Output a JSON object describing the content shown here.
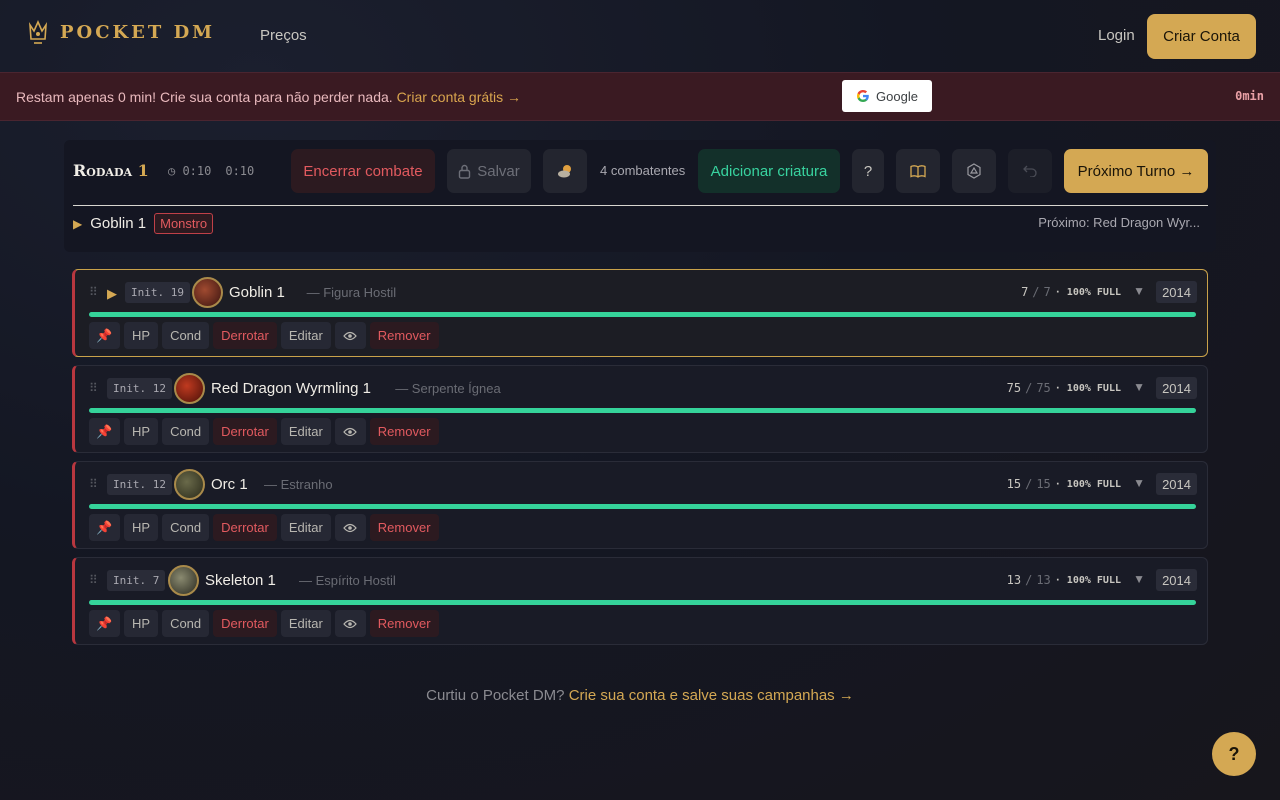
{
  "header": {
    "logo_text": "POCKET DM",
    "nav_precos": "Preços",
    "login": "Login",
    "criar_conta": "Criar Conta"
  },
  "banner": {
    "message": "Restam apenas 0 min! Crie sua conta para não perder nada.",
    "link": "Criar conta grátis →",
    "google_label": "Google",
    "timer": "0min"
  },
  "combat": {
    "rodada_label": "Rodada",
    "rodada_num": "1",
    "time1": "0:10",
    "time2": "0:10",
    "encerrar": "Encerrar combate",
    "salvar": "Salvar",
    "combatentes": "4 combatentes",
    "adicionar": "Adicionar criatura",
    "help": "?",
    "proximo": "Próximo Turno →",
    "current_name": "Goblin 1",
    "current_badge": "Monstro",
    "next_label": "Próximo: Red Dragon Wyr..."
  },
  "actions": {
    "hp": "HP",
    "cond": "Cond",
    "derrotar": "Derrotar",
    "editar": "Editar",
    "remover": "Remover"
  },
  "combatants": [
    {
      "init": "Init. 19",
      "name": "Goblin 1",
      "sub": "— Figura Hostil",
      "hp": "7",
      "max": "7",
      "full": "· 100% FULL",
      "edition": "2014"
    },
    {
      "init": "Init. 12",
      "name": "Red Dragon Wyrmling 1",
      "sub": "— Serpente Ígnea",
      "hp": "75",
      "max": "75",
      "full": "· 100% FULL",
      "edition": "2014"
    },
    {
      "init": "Init. 12",
      "name": "Orc 1",
      "sub": "— Estranho",
      "hp": "15",
      "max": "15",
      "full": "· 100% FULL",
      "edition": "2014"
    },
    {
      "init": "Init. 7",
      "name": "Skeleton 1",
      "sub": "— Espírito Hostil",
      "hp": "13",
      "max": "13",
      "full": "· 100% FULL",
      "edition": "2014"
    }
  ],
  "footer": {
    "text": "Curtiu o Pocket DM?",
    "link": "Crie sua conta e salve suas campanhas →"
  },
  "fab": "?"
}
